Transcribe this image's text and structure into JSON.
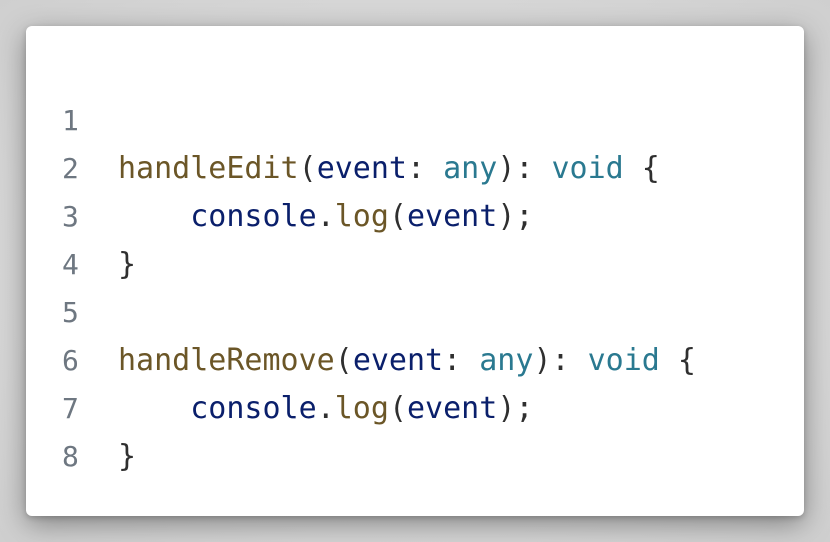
{
  "editor": {
    "lines": [
      {
        "number": "1",
        "tokens": []
      },
      {
        "number": "2",
        "tokens": [
          {
            "text": "handleEdit",
            "kind": "fn"
          },
          {
            "text": "(",
            "kind": "pu"
          },
          {
            "text": "event",
            "kind": "id"
          },
          {
            "text": ": ",
            "kind": "pu"
          },
          {
            "text": "any",
            "kind": "ty"
          },
          {
            "text": "): ",
            "kind": "pu"
          },
          {
            "text": "void",
            "kind": "ty"
          },
          {
            "text": " {",
            "kind": "pu"
          }
        ]
      },
      {
        "number": "3",
        "tokens": [
          {
            "text": "    ",
            "kind": "pu"
          },
          {
            "text": "console",
            "kind": "id"
          },
          {
            "text": ".",
            "kind": "pu"
          },
          {
            "text": "log",
            "kind": "fn"
          },
          {
            "text": "(",
            "kind": "pu"
          },
          {
            "text": "event",
            "kind": "id"
          },
          {
            "text": ");",
            "kind": "pu"
          }
        ]
      },
      {
        "number": "4",
        "tokens": [
          {
            "text": "}",
            "kind": "pu"
          }
        ]
      },
      {
        "number": "5",
        "tokens": []
      },
      {
        "number": "6",
        "tokens": [
          {
            "text": "handleRemove",
            "kind": "fn"
          },
          {
            "text": "(",
            "kind": "pu"
          },
          {
            "text": "event",
            "kind": "id"
          },
          {
            "text": ": ",
            "kind": "pu"
          },
          {
            "text": "any",
            "kind": "ty"
          },
          {
            "text": "): ",
            "kind": "pu"
          },
          {
            "text": "void",
            "kind": "ty"
          },
          {
            "text": " {",
            "kind": "pu"
          }
        ]
      },
      {
        "number": "7",
        "tokens": [
          {
            "text": "    ",
            "kind": "pu"
          },
          {
            "text": "console",
            "kind": "id"
          },
          {
            "text": ".",
            "kind": "pu"
          },
          {
            "text": "log",
            "kind": "fn"
          },
          {
            "text": "(",
            "kind": "pu"
          },
          {
            "text": "event",
            "kind": "id"
          },
          {
            "text": ");",
            "kind": "pu"
          }
        ]
      },
      {
        "number": "8",
        "tokens": [
          {
            "text": "}",
            "kind": "pu"
          }
        ]
      }
    ]
  },
  "colors": {
    "function": "#6b5627",
    "identifier": "#0a1f6b",
    "type": "#2a7990",
    "punctuation": "#2f2f2f",
    "line_number": "#6e7781",
    "card_background": "#ffffff"
  }
}
